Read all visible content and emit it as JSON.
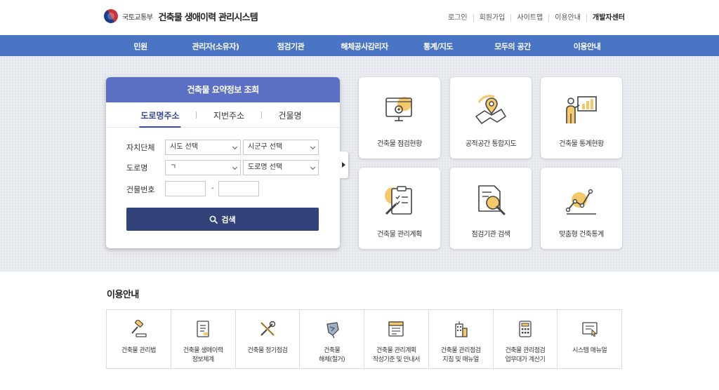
{
  "header": {
    "ministry": "국토교통부",
    "system_name": "건축물 생애이력 관리시스템",
    "util_links": [
      "로그인",
      "회원가입",
      "사이트맵",
      "이용안내",
      "개발자센터"
    ]
  },
  "nav": [
    "민원",
    "관리자(소유자)",
    "점검기관",
    "해체공사감리자",
    "통계/지도",
    "모두의 공간",
    "이용안내"
  ],
  "search": {
    "title": "건축물 요약정보 조회",
    "tabs": [
      "도로명주소",
      "지번주소",
      "건물명"
    ],
    "label_region": "자치단체",
    "label_road": "도로명",
    "label_number": "건물번호",
    "sido": "시도 선택",
    "sigungu": "시군구 선택",
    "road_initial": "ㄱ",
    "road_select": "도로명 선택",
    "dash": "-",
    "button": "검색"
  },
  "tiles": [
    "건축물 점검현황",
    "공적공간 통합지도",
    "건축물 통계현황",
    "건축물 관리계획",
    "점검기관 검색",
    "맞춤형 건축통계"
  ],
  "guide": {
    "title": "이용안내",
    "items": [
      "건축물 관리법",
      "건축물 생애이력\n정보체계",
      "건축물 정기점검",
      "건축물\n해체(철거)",
      "건축물 관리계획\n작성기준 및 안내서",
      "건축물 관리점검\n지침 및 매뉴얼",
      "건축물 관리점검\n업무대가 계산기",
      "시스템 매뉴얼"
    ]
  },
  "colors": {
    "nav": "#4a74c4",
    "card_head": "#5b6fc4",
    "button": "#34427a",
    "accent_yellow": "#f5c86a"
  }
}
